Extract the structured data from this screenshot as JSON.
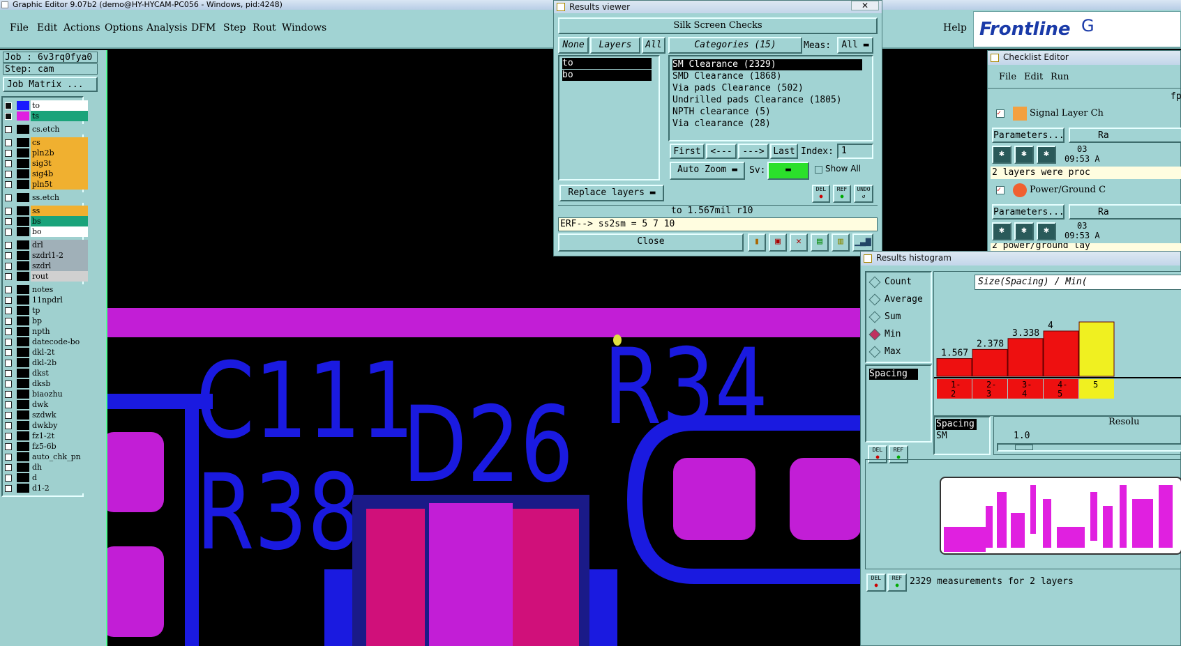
{
  "window_title": "Graphic Editor 9.07b2 (demo@HY-HYCAM-PC056 - Windows, pid:4248)",
  "menu": [
    "File",
    "Edit",
    "Actions",
    "Options",
    "Analysis",
    "DFM",
    "Step",
    "Rout",
    "Windows"
  ],
  "help": "Help",
  "brand": "Frontline",
  "brand_suffix": "G",
  "job_label": "Job : 6v3rq0fya0",
  "step_label": "Step: cam",
  "job_matrix": "Job Matrix ...",
  "layers": [
    {
      "name": "to",
      "swatch": "#1a1aff",
      "bg": "#ffffff",
      "checked": true
    },
    {
      "name": "ts",
      "swatch": "#e020e0",
      "bg": "#1aa37a",
      "checked": true
    },
    {
      "name": "cs.etch",
      "swatch": "#000000",
      "bg": "#9fd0cf",
      "checked": false
    },
    {
      "name": "cs",
      "swatch": "#000000",
      "bg": "#f0b030",
      "checked": false
    },
    {
      "name": "pln2b",
      "swatch": "#000000",
      "bg": "#f0b030",
      "checked": false
    },
    {
      "name": "sig3t",
      "swatch": "#000000",
      "bg": "#f0b030",
      "checked": false
    },
    {
      "name": "sig4b",
      "swatch": "#000000",
      "bg": "#f0b030",
      "checked": false
    },
    {
      "name": "pln5t",
      "swatch": "#000000",
      "bg": "#f0b030",
      "checked": false
    },
    {
      "name": "ss.etch",
      "swatch": "#000000",
      "bg": "#9fd0cf",
      "checked": false
    },
    {
      "name": "ss",
      "swatch": "#000000",
      "bg": "#f0b030",
      "checked": false
    },
    {
      "name": "bs",
      "swatch": "#000000",
      "bg": "#1aa37a",
      "checked": false
    },
    {
      "name": "bo",
      "swatch": "#000000",
      "bg": "#ffffff",
      "checked": false
    },
    {
      "name": "drl",
      "swatch": "#000000",
      "bg": "#a0b0b8",
      "checked": false
    },
    {
      "name": "szdrl1-2",
      "swatch": "#000000",
      "bg": "#a0b0b8",
      "checked": false
    },
    {
      "name": "szdrl",
      "swatch": "#000000",
      "bg": "#a0b0b8",
      "checked": false
    },
    {
      "name": "rout",
      "swatch": "#000000",
      "bg": "#d0d0d0",
      "checked": false
    },
    {
      "name": "notes",
      "swatch": "#000000",
      "bg": "#9fd0cf",
      "checked": false
    },
    {
      "name": "11npdrl",
      "swatch": "#000000",
      "bg": "#9fd0cf",
      "checked": false
    },
    {
      "name": "tp",
      "swatch": "#000000",
      "bg": "#9fd0cf",
      "checked": false
    },
    {
      "name": "bp",
      "swatch": "#000000",
      "bg": "#9fd0cf",
      "checked": false
    },
    {
      "name": "npth",
      "swatch": "#000000",
      "bg": "#9fd0cf",
      "checked": false
    },
    {
      "name": "datecode-bo",
      "swatch": "#000000",
      "bg": "#9fd0cf",
      "checked": false
    },
    {
      "name": "dkl-2t",
      "swatch": "#000000",
      "bg": "#9fd0cf",
      "checked": false
    },
    {
      "name": "dkl-2b",
      "swatch": "#000000",
      "bg": "#9fd0cf",
      "checked": false
    },
    {
      "name": "dkst",
      "swatch": "#000000",
      "bg": "#9fd0cf",
      "checked": false
    },
    {
      "name": "dksb",
      "swatch": "#000000",
      "bg": "#9fd0cf",
      "checked": false
    },
    {
      "name": "biaozhu",
      "swatch": "#000000",
      "bg": "#9fd0cf",
      "checked": false
    },
    {
      "name": "dwk",
      "swatch": "#000000",
      "bg": "#9fd0cf",
      "checked": false
    },
    {
      "name": "szdwk",
      "swatch": "#000000",
      "bg": "#9fd0cf",
      "checked": false
    },
    {
      "name": "dwkby",
      "swatch": "#000000",
      "bg": "#9fd0cf",
      "checked": false
    },
    {
      "name": "fz1-2t",
      "swatch": "#000000",
      "bg": "#9fd0cf",
      "checked": false
    },
    {
      "name": "fz5-6b",
      "swatch": "#000000",
      "bg": "#9fd0cf",
      "checked": false
    },
    {
      "name": "auto_chk_pn",
      "swatch": "#000000",
      "bg": "#9fd0cf",
      "checked": false
    },
    {
      "name": "dh",
      "swatch": "#000000",
      "bg": "#9fd0cf",
      "checked": false
    },
    {
      "name": "d",
      "swatch": "#000000",
      "bg": "#9fd0cf",
      "checked": false
    },
    {
      "name": "d1-2",
      "swatch": "#000000",
      "bg": "#9fd0cf",
      "checked": false
    }
  ],
  "pcb_labels": [
    "C111",
    "D26",
    "R34",
    "R38"
  ],
  "results": {
    "title": "Results viewer",
    "header": "Silk Screen Checks",
    "none": "None",
    "layers_label": "Layers",
    "all": "All",
    "layer_list": [
      "to",
      "bo"
    ],
    "categories_label": "Categories (15)",
    "meas_label": "Meas:",
    "meas_value": "All",
    "categories": [
      "SM Clearance (2329)",
      "SMD Clearance (1868)",
      "Via pads Clearance (502)",
      "Undrilled pads Clearance (1805)",
      "NPTH clearance (5)",
      "Via clearance (28)"
    ],
    "first": "First",
    "prev": "<---",
    "next": "--->",
    "last": "Last",
    "index_label": "Index:",
    "index_value": "1",
    "auto_zoom": "Auto Zoom",
    "sv_label": "Sv:",
    "show_all": "Show All",
    "replace_layers": "Replace layers",
    "del": "DEL",
    "ref": "REF",
    "undo": "UNDO",
    "status": "to 1.567mil  r10",
    "erf": "ERF--> ss2sm = 5 7 10",
    "close": "Close"
  },
  "checklist": {
    "title": "Checklist Editor",
    "menu": [
      "File",
      "Edit",
      "Run"
    ],
    "name_partial": "fp",
    "item1": "Signal Layer Ch",
    "item2": "Power/Ground C",
    "parameters": "Parameters...",
    "run_partial": "Ra",
    "date": "03",
    "time1": "09:53 A",
    "time2": "09:53 A",
    "msg1": "2 layers were proc",
    "msg2": "2 power/ground lay"
  },
  "histogram": {
    "title": "Results histogram",
    "modes": [
      "Count",
      "Average",
      "Sum",
      "Min",
      "Max"
    ],
    "selected_mode": "Min",
    "list_label": "Spacing",
    "chart_title": "Size(Spacing) / Min(",
    "bins": [
      "1-2",
      "2-3",
      "3-4",
      "4-5",
      "5"
    ],
    "values_text": [
      "1.567",
      "2.378",
      "3.338",
      "4"
    ],
    "list2_header": "Spacing",
    "list2_item": "SM",
    "resolution_label": "Resolu",
    "resolution_value": "1.0",
    "summary": "2329 measurements for 2 layers"
  },
  "chart_data": {
    "type": "bar",
    "title": "Size(Spacing) / Min(",
    "categories": [
      "1-2",
      "2-3",
      "3-4",
      "4-5",
      "5-"
    ],
    "values": [
      1.567,
      2.378,
      3.338,
      4,
      4.8
    ]
  }
}
